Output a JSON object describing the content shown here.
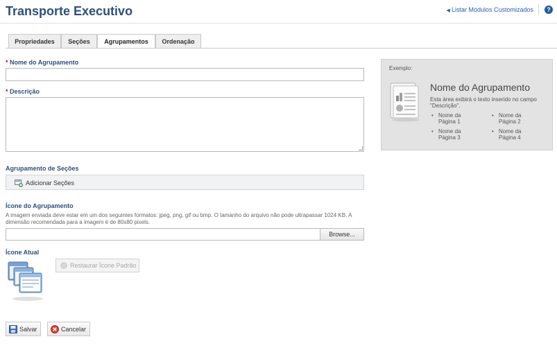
{
  "header": {
    "title": "Transporte Executivo",
    "list_link": "Listar Módulos Customizados",
    "help_icon": "?"
  },
  "tabs": [
    {
      "label": "Propriedades"
    },
    {
      "label": "Seções"
    },
    {
      "label": "Agrupamentos",
      "active": true
    },
    {
      "label": "Ordenação"
    }
  ],
  "form": {
    "name_label": "Nome do Agrupamento",
    "name_value": "",
    "description_label": "Descrição",
    "description_value": "",
    "required_mark": "*",
    "group_sections_label": "Agrupamento de Seções",
    "add_sections_button": "Adicionar Seções",
    "icon_label": "Ícone do Agrupamento",
    "icon_help": "A imagem enviada deve estar em um dos seguintes formatos: jpeg, png, gif ou bmp. O tamanho do arquivo não pode ultrapassar 1024 KB. A dimensão recomendada para a imagem é de 80x80 pixels.",
    "file_value": "",
    "browse_button": "Browse...",
    "current_icon_label": "Ícone Atual",
    "restore_button": "Restaurar Ícone Padrão"
  },
  "example": {
    "label": "Exemplo:",
    "title": "Nome do Agrupamento",
    "description": "Esta área exibirá o texto inserido no campo \"Descrição\".",
    "items": [
      "Nome da Página 1",
      "Nome da Página 2",
      "Nome da Página 3",
      "Nome da Página 4"
    ]
  },
  "footer": {
    "save_button": "Salvar",
    "cancel_button": "Cancelar"
  },
  "colors": {
    "title": "#2e4f7a",
    "link": "#2b5ea8",
    "required": "#c8102e",
    "help_icon": "#1f5b9e"
  },
  "icons": [
    "chevron-left-icon",
    "help-icon",
    "add-sections-icon",
    "restore-icon",
    "save-icon",
    "cancel-icon",
    "group-icon",
    "page-icon"
  ]
}
